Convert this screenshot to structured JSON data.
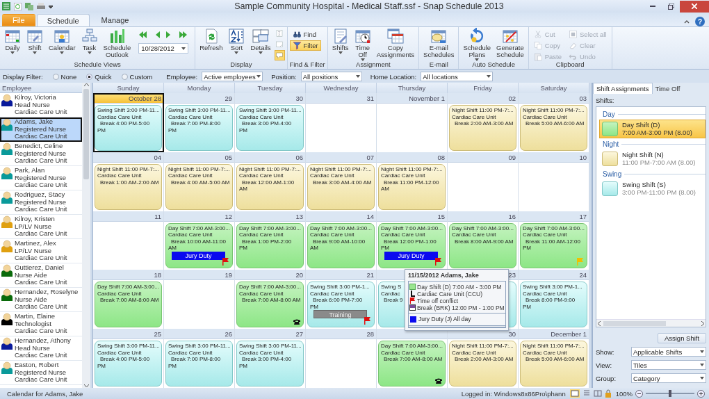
{
  "window": {
    "title": "Sample Community Hospital - Medical Staff.ssf - Snap Schedule 2013",
    "help": "?"
  },
  "tabs": [
    {
      "label": "File",
      "kind": "file",
      "selected": false
    },
    {
      "label": "Schedule",
      "kind": "tab",
      "selected": true
    },
    {
      "label": "Manage",
      "kind": "tab",
      "selected": false
    }
  ],
  "ribbon": {
    "groups": [
      {
        "label": "Schedule Views",
        "items": [
          {
            "kind": "big",
            "label": [
              "Daily"
            ],
            "dropdown": true
          },
          {
            "kind": "big",
            "label": [
              "Shift"
            ],
            "dropdown": true
          },
          {
            "kind": "big",
            "label": [
              "Calendar"
            ],
            "dropdown": true
          },
          {
            "kind": "big",
            "label": [
              "Task"
            ],
            "dropdown": true
          },
          {
            "kind": "big",
            "label": [
              "Schedule",
              "Outlook"
            ],
            "dropdown": false
          },
          {
            "kind": "date_nav",
            "value": "10/28/2012"
          }
        ]
      },
      {
        "label": "Display",
        "items": [
          {
            "kind": "big",
            "label": [
              "Refresh"
            ],
            "dropdown": false
          },
          {
            "kind": "big",
            "label": [
              "Sort"
            ],
            "dropdown": true
          },
          {
            "kind": "big",
            "label": [
              "Details"
            ],
            "dropdown": true
          },
          {
            "kind": "icon_column",
            "buttons": [
              {
                "selected": false
              },
              {
                "selected": false
              },
              {
                "selected": true
              }
            ]
          }
        ]
      },
      {
        "label": "Find & Filter",
        "items": [
          {
            "kind": "small_column",
            "buttons": [
              {
                "label": "Find",
                "selected": false,
                "disabled": false
              },
              {
                "label": "Filter",
                "selected": true,
                "disabled": false
              }
            ]
          }
        ]
      },
      {
        "label": "Assignment",
        "items": [
          {
            "kind": "big",
            "label": [
              "Shifts"
            ],
            "dropdown": true
          },
          {
            "kind": "big",
            "label": [
              "Time",
              "Off"
            ],
            "dropdown": true
          },
          {
            "kind": "big",
            "label": [
              "Copy",
              "Assignments"
            ],
            "dropdown": false
          }
        ]
      },
      {
        "label": "E-mail",
        "items": [
          {
            "kind": "big",
            "label": [
              "E-mail",
              "Schedules"
            ],
            "dropdown": false
          }
        ]
      },
      {
        "label": "Auto Schedule",
        "items": [
          {
            "kind": "big",
            "label": [
              "Schedule",
              "Plans"
            ],
            "dropdown": true
          },
          {
            "kind": "big",
            "label": [
              "Generate",
              "Schedule"
            ],
            "dropdown": false
          }
        ]
      },
      {
        "label": "Clipboard",
        "items": [
          {
            "kind": "small_column",
            "buttons": [
              {
                "label": "Cut",
                "selected": false,
                "disabled": true
              },
              {
                "label": "Copy",
                "selected": false,
                "disabled": true
              },
              {
                "label": "Paste",
                "selected": false,
                "disabled": true
              }
            ]
          },
          {
            "kind": "small_column",
            "buttons": [
              {
                "label": "Select all",
                "selected": false,
                "disabled": true
              },
              {
                "label": "Clear",
                "selected": false,
                "disabled": true
              },
              {
                "label": "Undo",
                "selected": false,
                "disabled": true
              }
            ]
          }
        ]
      }
    ]
  },
  "filter_bar": {
    "label": "Display Filter:",
    "options": [
      {
        "label": "None",
        "selected": false
      },
      {
        "label": "Quick",
        "selected": true
      },
      {
        "label": "Custom",
        "selected": false
      }
    ],
    "fields": [
      {
        "label": "Employee:",
        "value": "Active employees"
      },
      {
        "label": "Position:",
        "value": "All positions"
      },
      {
        "label": "Home Location:",
        "value": "All locations"
      }
    ]
  },
  "employees": {
    "header": "Employee",
    "items": [
      {
        "name": "Kilroy, Victoria",
        "position": "Head Nurse",
        "unit": "Cardiac Care Unit",
        "color": "#0a1a9a",
        "selected": false
      },
      {
        "name": "Adams, Jake",
        "position": "Registered Nurse",
        "unit": "Cardiac Care Unit",
        "color": "#0a9a9a",
        "selected": true
      },
      {
        "name": "Benedict, Celine",
        "position": "Registered Nurse",
        "unit": "Cardiac Care Unit",
        "color": "#0a9a9a",
        "selected": false
      },
      {
        "name": "Park, Alan",
        "position": "Registered Nurse",
        "unit": "Cardiac Care Unit",
        "color": "#0a9a9a",
        "selected": false
      },
      {
        "name": "Rodriguez, Stacy",
        "position": "Registered Nurse",
        "unit": "Cardiac Care Unit",
        "color": "#0a9a9a",
        "selected": false
      },
      {
        "name": "Kilroy, Kristen",
        "position": "LP/LV Nurse",
        "unit": "Cardiac Care Unit",
        "color": "#e0a010",
        "selected": false
      },
      {
        "name": "Martinez, Alex",
        "position": "LP/LV Nurse",
        "unit": "Cardiac Care Unit",
        "color": "#e0a010",
        "selected": false
      },
      {
        "name": "Guttierez, Daniel",
        "position": "Nurse Aide",
        "unit": "Cardiac Care Unit",
        "color": "#0a6a0a",
        "selected": false
      },
      {
        "name": "Hernandez, Roselyne",
        "position": "Nurse Aide",
        "unit": "Cardiac Care Unit",
        "color": "#0a6a0a",
        "selected": false
      },
      {
        "name": "Martin, Elaine",
        "position": "Technologist",
        "unit": "Cardiac Care Unit",
        "color": "#000000",
        "selected": false
      },
      {
        "name": "Hernandez, Athony",
        "position": "Head Nurse",
        "unit": "Cardiac Care Unit",
        "color": "#0a1a9a",
        "selected": false
      },
      {
        "name": "Easton, Robert",
        "position": "Registered Nurse",
        "unit": "Cardiac Care Unit",
        "color": "#0a9a9a",
        "selected": false
      }
    ]
  },
  "calendar": {
    "days": [
      "Sunday",
      "Monday",
      "Tuesday",
      "Wednesday",
      "Thursday",
      "Friday",
      "Saturday"
    ],
    "weeks": [
      [
        {
          "date": "October 28",
          "selected": true,
          "kind": "swing",
          "title": "Swing Shift 3:00 PM-11...",
          "unit": "Cardiac Care Unit",
          "brk": "Break 4:00 PM-5:00 PM"
        },
        {
          "date": "29",
          "selected": false,
          "kind": "swing",
          "title": "Swing Shift 3:00 PM-11...",
          "unit": "Cardiac Care Unit",
          "brk": "Break 7:00 PM-8:00 PM"
        },
        {
          "date": "30",
          "selected": false,
          "kind": "swing",
          "title": "Swing Shift 3:00 PM-11...",
          "unit": "Cardiac Care Unit",
          "brk": "Break 3:00 PM-4:00 PM"
        },
        {
          "date": "31",
          "selected": false
        },
        {
          "date": "November 1",
          "selected": false
        },
        {
          "date": "02",
          "selected": false,
          "kind": "night",
          "title": "Night Shift 11:00 PM-7:...",
          "unit": "Cardiac Care Unit",
          "brk": "Break 2:00 AM-3:00 AM"
        },
        {
          "date": "03",
          "selected": false,
          "kind": "night",
          "title": "Night Shift 11:00 PM-7:...",
          "unit": "Cardiac Care Unit",
          "brk": "Break 5:00 AM-6:00 AM"
        }
      ],
      [
        {
          "date": "04",
          "selected": false,
          "kind": "night",
          "title": "Night Shift 11:00 PM-7:...",
          "unit": "Cardiac Care Unit",
          "brk": "Break 1:00 AM-2:00 AM"
        },
        {
          "date": "05",
          "selected": false,
          "kind": "night",
          "title": "Night Shift 11:00 PM-7:...",
          "unit": "Cardiac Care Unit",
          "brk": "Break 4:00 AM-5:00 AM"
        },
        {
          "date": "06",
          "selected": false,
          "kind": "night",
          "title": "Night Shift 11:00 PM-7:...",
          "unit": "Cardiac Care Unit",
          "brk": "Break 12:00 AM-1:00 AM"
        },
        {
          "date": "07",
          "selected": false,
          "kind": "night",
          "title": "Night Shift 11:00 PM-7:...",
          "unit": "Cardiac Care Unit",
          "brk": "Break 3:00 AM-4:00 AM"
        },
        {
          "date": "08",
          "selected": false,
          "kind": "night",
          "title": "Night Shift 11:00 PM-7:...",
          "unit": "Cardiac Care Unit",
          "brk": "Break 11:00 PM-12:00 AM"
        },
        {
          "date": "09",
          "selected": false
        },
        {
          "date": "10",
          "selected": false
        }
      ],
      [
        {
          "date": "11",
          "selected": false
        },
        {
          "date": "12",
          "selected": false,
          "kind": "day",
          "title": "Day Shift 7:00 AM-3:00...",
          "unit": "Cardiac Care Unit",
          "brk": "Break 10:00 AM-11:00 AM",
          "bar": {
            "kind": "jury",
            "label": "Jury Duty"
          },
          "marker": {
            "kind": "flag",
            "color": "#e01010"
          }
        },
        {
          "date": "13",
          "selected": false,
          "kind": "day",
          "title": "Day Shift 7:00 AM-3:00...",
          "unit": "Cardiac Care Unit",
          "brk": "Break 1:00 PM-2:00 PM"
        },
        {
          "date": "14",
          "selected": false,
          "kind": "day",
          "title": "Day Shift 7:00 AM-3:00...",
          "unit": "Cardiac Care Unit",
          "brk": "Break 9:00 AM-10:00 AM"
        },
        {
          "date": "15",
          "selected": false,
          "kind": "day",
          "title": "Day Shift 7:00 AM-3:00...",
          "unit": "Cardiac Care Unit",
          "brk": "Break 12:00 PM-1:00 PM",
          "bar": {
            "kind": "jury",
            "label": "Jury Duty"
          },
          "marker": {
            "kind": "flag",
            "color": "#e01010"
          }
        },
        {
          "date": "16",
          "selected": false,
          "kind": "day",
          "title": "Day Shift 7:00 AM-3:00...",
          "unit": "Cardiac Care Unit",
          "brk": "Break 8:00 AM-9:00 AM"
        },
        {
          "date": "17",
          "selected": false,
          "kind": "day",
          "title": "Day Shift 7:00 AM-3:00...",
          "unit": "Cardiac Care Unit",
          "brk": "Break 11:00 AM-12:00 PM",
          "marker": {
            "kind": "flag",
            "color": "#f0c000"
          }
        }
      ],
      [
        {
          "date": "18",
          "selected": false,
          "kind": "day",
          "title": "Day Shift 7:00 AM-3:00...",
          "unit": "Cardiac Care Unit",
          "brk": "Break 7:00 AM-8:00 AM"
        },
        {
          "date": "19",
          "selected": false
        },
        {
          "date": "20",
          "selected": false,
          "kind": "day",
          "title": "Day Shift 7:00 AM-3:00...",
          "unit": "Cardiac Care Unit",
          "brk": "Break 7:00 AM-8:00 AM",
          "marker": {
            "kind": "phone"
          }
        },
        {
          "date": "21",
          "selected": false,
          "kind": "swing",
          "title": "Swing Shift 3:00 PM-1...",
          "unit": "Cardiac Care Unit",
          "brk": "Break 6:00 PM-7:00 PM",
          "bar": {
            "kind": "training",
            "label": "Training"
          },
          "marker": {
            "kind": "flag",
            "color": "#e01010"
          }
        },
        {
          "selected": false,
          "kind": "swing",
          "title": "Swing S",
          "unit": "Cardiac",
          "brk": "Break 9"
        },
        {
          "date": "23",
          "selected": false,
          "kind": "swing"
        },
        {
          "date": "24",
          "selected": false,
          "kind": "swing",
          "title": "Swing Shift 3:00 PM-1...",
          "unit": "Cardiac Care Unit",
          "brk": "Break 8:00 PM-9:00 PM"
        }
      ],
      [
        {
          "date": "25",
          "selected": false,
          "kind": "swing",
          "title": "Swing Shift 3:00 PM-11...",
          "unit": "Cardiac Care Unit",
          "brk": "Break 4:00 PM-5:00 PM"
        },
        {
          "date": "26",
          "selected": false,
          "kind": "swing",
          "title": "Swing Shift 3:00 PM-11...",
          "unit": "Cardiac Care Unit",
          "brk": "Break 7:00 PM-8:00 PM"
        },
        {
          "date": "27",
          "selected": false,
          "kind": "swing",
          "title": "Swing Shift 3:00 PM-11...",
          "unit": "Cardiac Care Unit",
          "brk": "Break 3:00 PM-4:00 PM"
        },
        {
          "date": "28",
          "selected": false
        },
        {
          "selected": false,
          "kind": "day",
          "title": "Day Shift 7:00 AM-3:00...",
          "unit": "Cardiac Care Unit",
          "brk": "Break 7:00 AM-8:00 AM",
          "marker": {
            "kind": "phone"
          }
        },
        {
          "date": "30",
          "selected": false,
          "kind": "night",
          "title": "Night Shift 11:00 PM-7:...",
          "unit": "Cardiac Care Unit",
          "brk": "Break 2:00 AM-3:00 AM"
        },
        {
          "date": "December 1",
          "selected": false,
          "kind": "night",
          "title": "Night Shift 11:00 PM-7:...",
          "unit": "Cardiac Care Unit",
          "brk": "Break 5:00 AM-6:00 AM"
        }
      ]
    ]
  },
  "tooltip": {
    "title": "11/15/2012 Adams, Jake",
    "lines": [
      {
        "kind": "shift",
        "text": "Day Shift (D) 7:00 AM - 3:00 PM"
      },
      {
        "kind": "unit",
        "text": "Cardiac Care Unit (CCU)"
      },
      {
        "kind": "conflict",
        "text": "Time off conflict"
      },
      {
        "kind": "break",
        "text": "Break (BRK) 12:00 PM - 1:00 PM"
      }
    ],
    "time_off": "Jury Duty (J) All day"
  },
  "side_panel": {
    "tabs": [
      {
        "label": "Shift Assignments",
        "selected": true
      },
      {
        "label": "Time Off",
        "selected": false
      }
    ],
    "shifts_label": "Shifts:",
    "groups": [
      {
        "name": "Day",
        "items": [
          {
            "name": "Day Shift (D)",
            "time": "7:00 AM-3:00 PM (8.00)",
            "kind": "day",
            "selected": true
          }
        ]
      },
      {
        "name": "Night",
        "items": [
          {
            "name": "Night Shift (N)",
            "time": "11:00 PM-7:00 AM (8.00)",
            "kind": "night",
            "selected": false
          }
        ]
      },
      {
        "name": "Swing",
        "items": [
          {
            "name": "Swing Shift (S)",
            "time": "3:00 PM-11:00 PM (8.00)",
            "kind": "swing",
            "selected": false
          }
        ]
      }
    ],
    "assign_button": "Assign Shift",
    "fields": [
      {
        "label": "Show:",
        "value": "Applicable Shifts"
      },
      {
        "label": "View:",
        "value": "Tiles"
      },
      {
        "label": "Group:",
        "value": "Category"
      }
    ]
  },
  "status_bar": {
    "text": "Calendar for Adams, Jake",
    "login": "Logged in: Windows8x86Pro\\phann",
    "zoom": "100%",
    "zoom_slider": {
      "level": 0.5
    }
  }
}
